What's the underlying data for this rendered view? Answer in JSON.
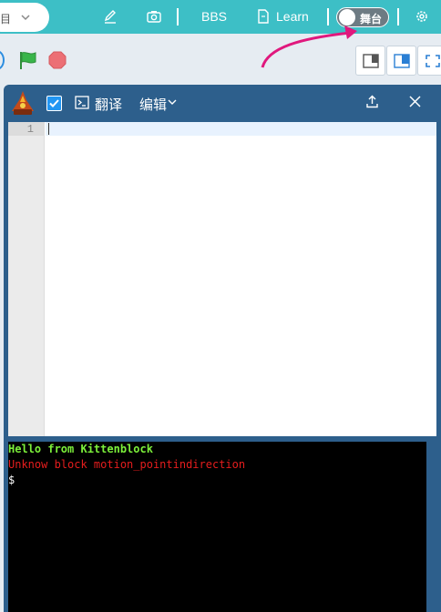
{
  "topbar": {
    "select_glyph": "目",
    "bbs_label": "BBS",
    "learn_label": "Learn",
    "stage_toggle_label": "舞台"
  },
  "dialog": {
    "translate_label": "翻译",
    "edit_label": "编辑"
  },
  "editor": {
    "line_numbers": [
      "1"
    ],
    "content": ""
  },
  "terminal": {
    "lines": [
      {
        "text": "Hello from Kittenblock",
        "color": "#7cf03a"
      },
      {
        "text": "Unknow block motion_pointindirection",
        "color": "#e51d1d"
      },
      {
        "text": "$",
        "color": "#ffffff"
      }
    ]
  },
  "colors": {
    "topbar_bg": "#3dbfc6",
    "dialog_bg": "#2d5f8c",
    "annotation_arrow": "#e0187d",
    "flag_green": "#39b54a",
    "stop_red": "#ec6f75"
  }
}
